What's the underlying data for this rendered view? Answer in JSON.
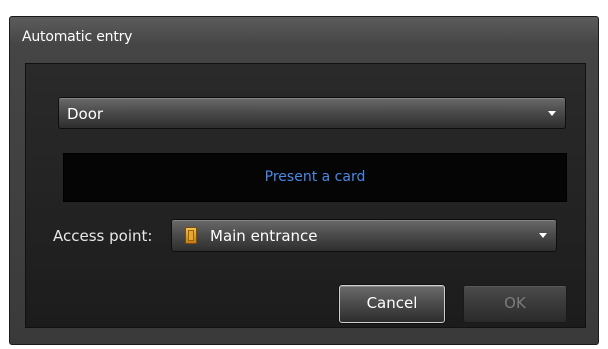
{
  "dialog": {
    "title": "Automatic entry"
  },
  "door_select": {
    "value": "Door",
    "icon": "chevron-down-icon"
  },
  "card_prompt": {
    "text": "Present a card",
    "color": "#4a88e6"
  },
  "access_point": {
    "label": "Access point:",
    "value": "Main entrance",
    "icon": "door-icon"
  },
  "buttons": {
    "cancel": "Cancel",
    "ok": "OK"
  }
}
